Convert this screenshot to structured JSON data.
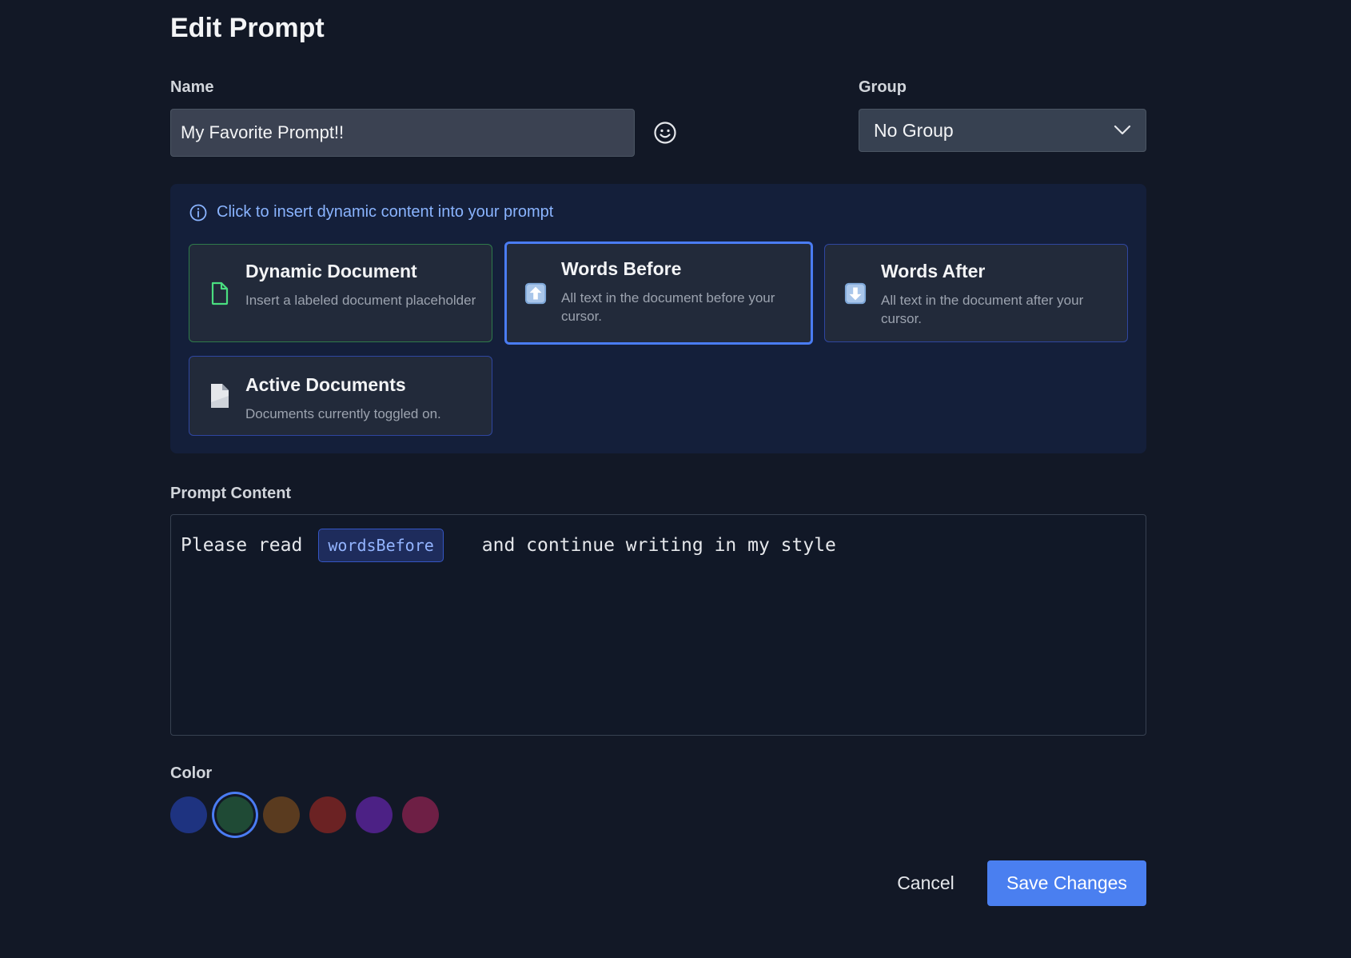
{
  "page": {
    "title": "Edit Prompt"
  },
  "name_field": {
    "label": "Name",
    "value": "My Favorite Prompt!!"
  },
  "group_field": {
    "label": "Group",
    "selected": "No Group"
  },
  "insert_panel": {
    "info": "Click to insert dynamic content into your prompt",
    "cards": [
      {
        "title": "Dynamic Document",
        "description": "Insert a labeled document placeholder",
        "icon": "document-outline-icon"
      },
      {
        "title": "Words Before",
        "description": "All text in the document before your cursor.",
        "icon": "arrow-up-box-icon",
        "selected": true
      },
      {
        "title": "Words After",
        "description": "All text in the document after your cursor.",
        "icon": "arrow-down-box-icon"
      },
      {
        "title": "Active Documents",
        "description": "Documents currently toggled on.",
        "icon": "page-icon"
      }
    ]
  },
  "prompt_content": {
    "label": "Prompt Content",
    "before_text": "Please read",
    "token": "wordsBefore",
    "after_text": "and continue writing in my style"
  },
  "color_field": {
    "label": "Color",
    "swatches": [
      "#1e3380",
      "#1f4a35",
      "#5a3b1f",
      "#6b2223",
      "#4c2185",
      "#6e1f45"
    ],
    "selected_index": 1
  },
  "actions": {
    "cancel": "Cancel",
    "save": "Save Changes"
  }
}
